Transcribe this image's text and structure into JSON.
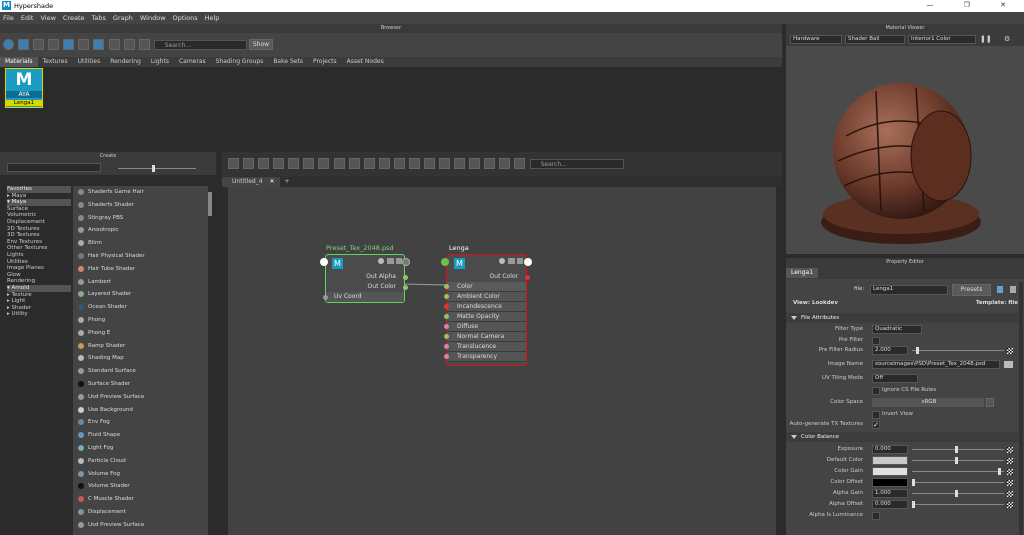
{
  "window": {
    "title": "Hypershade",
    "app_badge": "M",
    "controls": [
      "—",
      "❐",
      "✕"
    ]
  },
  "menu": [
    "File",
    "Edit",
    "View",
    "Create",
    "Tabs",
    "Graph",
    "Window",
    "Options",
    "Help"
  ],
  "browser": {
    "header": "Browser",
    "search_placeholder": "Search...",
    "show_label": "Show",
    "tabs": [
      "Materials",
      "Textures",
      "Utilities",
      "Rendering",
      "Lights",
      "Cameras",
      "Shading Groups",
      "Bake Sets",
      "Projects",
      "Asset Nodes"
    ],
    "active_tab": 0,
    "material": {
      "logo": "M",
      "brand": "AYA",
      "name": "Lenga1"
    }
  },
  "material_viewer": {
    "header": "Material Viewer",
    "renderer": "Hardware",
    "geometry": "Shader Ball",
    "env": "Interior1 Color"
  },
  "create": {
    "header": "Create",
    "tree": [
      {
        "label": "Favorites",
        "cat": true
      },
      {
        "label": "▸ Maya",
        "cat": false
      },
      {
        "label": "▾ Maya",
        "cat": true
      },
      {
        "label": "Surface",
        "cat": false
      },
      {
        "label": "Volumetric",
        "cat": false
      },
      {
        "label": "Displacement",
        "cat": false
      },
      {
        "label": "2D Textures",
        "cat": false
      },
      {
        "label": "3D Textures",
        "cat": false
      },
      {
        "label": "Env Textures",
        "cat": false
      },
      {
        "label": "Other Textures",
        "cat": false
      },
      {
        "label": "Lights",
        "cat": false
      },
      {
        "label": "Utilities",
        "cat": false
      },
      {
        "label": "Image Planes",
        "cat": false
      },
      {
        "label": "Glow",
        "cat": false
      },
      {
        "label": "Rendering",
        "cat": false
      },
      {
        "label": "▾ Arnold",
        "cat": true
      },
      {
        "label": "▸ Texture",
        "cat": false
      },
      {
        "label": "▸ Light",
        "cat": false
      },
      {
        "label": "▸ Shader",
        "cat": false
      },
      {
        "label": "▸ Utility",
        "cat": false
      }
    ],
    "shaders": [
      {
        "label": "Shaderfx Game Hair",
        "color": "#888"
      },
      {
        "label": "Shaderfx Shader",
        "color": "#888"
      },
      {
        "label": "Stingray PBS",
        "color": "#888"
      },
      {
        "label": "Anisotropic",
        "color": "#999"
      },
      {
        "label": "Blinn",
        "color": "#aaa"
      },
      {
        "label": "Hair Physical Shader",
        "color": "#777"
      },
      {
        "label": "Hair Tube Shader",
        "color": "#c86"
      },
      {
        "label": "Lambert",
        "color": "#999"
      },
      {
        "label": "Layered Shader",
        "color": "#8a8"
      },
      {
        "label": "Ocean Shader",
        "color": "#357"
      },
      {
        "label": "Phong",
        "color": "#aaa"
      },
      {
        "label": "Phong E",
        "color": "#aaa"
      },
      {
        "label": "Ramp Shader",
        "color": "#c95"
      },
      {
        "label": "Shading Map",
        "color": "#bbb"
      },
      {
        "label": "Standard Surface",
        "color": "#999"
      },
      {
        "label": "Surface Shader",
        "color": "#111"
      },
      {
        "label": "Usd Preview Surface",
        "color": "#999"
      },
      {
        "label": "Use Background",
        "color": "#ccc"
      },
      {
        "label": "Env Fog",
        "color": "#68a"
      },
      {
        "label": "Fluid Shape",
        "color": "#69b"
      },
      {
        "label": "Light Fog",
        "color": "#7ab"
      },
      {
        "label": "Particle Cloud",
        "color": "#bbb"
      },
      {
        "label": "Volume Fog",
        "color": "#79a"
      },
      {
        "label": "Volume Shader",
        "color": "#111"
      },
      {
        "label": "C Muscle Shader",
        "color": "#c55"
      },
      {
        "label": "Displacement",
        "color": "#79a"
      },
      {
        "label": "Usd Preview Surface",
        "color": "#999"
      }
    ]
  },
  "graph": {
    "tabs": [
      "Untitled_4"
    ],
    "search_placeholder": "Search...",
    "node_tex": {
      "title": "Preset_Tex_2048.psd",
      "outputs": [
        "Out Alpha",
        "Out Color"
      ],
      "input": "Uv Coord"
    },
    "node_mat": {
      "title": "Lenga",
      "output": "Out Color",
      "inputs": [
        "Color",
        "Ambient Color",
        "Incandescence",
        "Matte Opacity",
        "Diffuse",
        "Normal Camera",
        "Translucence",
        "Transparency"
      ]
    }
  },
  "property_editor": {
    "header": "Property Editor",
    "tab": "Lenga1",
    "file_label": "file:",
    "file_value": "Lenga1",
    "presets_label": "Presets",
    "view_label": "View: Lookdev",
    "template_label": "Template: file",
    "section_file": "File Attributes",
    "filter_type_label": "Filter Type",
    "filter_type_value": "Quadratic",
    "pre_filter_label": "Pre Filter",
    "pre_filter_radius_label": "Pre Filter Radius",
    "pre_filter_radius_value": "2.000",
    "image_name_label": "Image Name",
    "image_name_value": "sourceimages\\PSD\\Preset_Tex_2048.psd",
    "uv_tiling_label": "UV Tiling Mode",
    "uv_tiling_value": "Off",
    "ignore_cs_label": "Ignore CS File Rules",
    "color_space_label": "Color Space",
    "color_space_value": "sRGB",
    "invert_label": "Invert View",
    "auto_tx_label": "Auto-generate TX Textures",
    "section_balance": "Color Balance",
    "exposure_label": "Exposure",
    "exposure_value": "0.000",
    "default_color_label": "Default Color",
    "color_gain_label": "Color Gain",
    "color_offset_label": "Color Offset",
    "alpha_gain_label": "Alpha Gain",
    "alpha_gain_value": "1.000",
    "alpha_offset_label": "Alpha Offset",
    "alpha_offset_value": "0.000",
    "alpha_lum_label": "Alpha Is Luminance"
  }
}
